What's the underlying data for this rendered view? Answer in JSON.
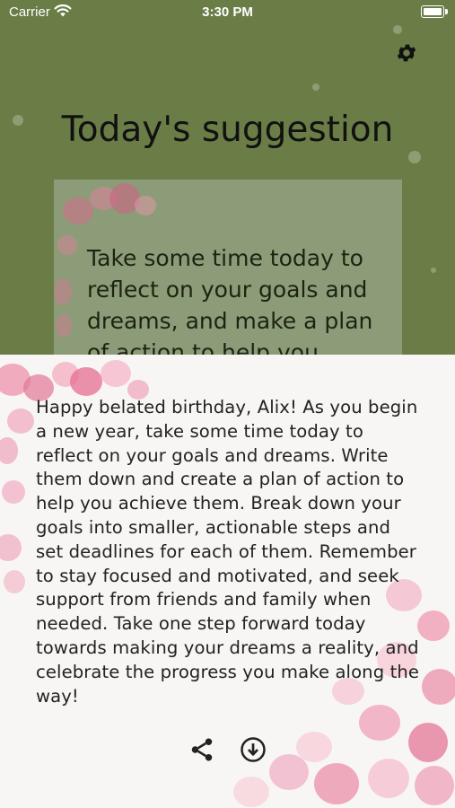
{
  "status_bar": {
    "carrier": "Carrier",
    "time": "3:30 PM"
  },
  "header": {
    "title": "Today's suggestion"
  },
  "preview_card": {
    "text": "Take some time today to reflect on your goals and dreams, and make a plan of action to help you"
  },
  "message": {
    "text": "Happy belated birthday, Alix! As you begin a new year, take some time today to reflect on your goals and dreams. Write them down and create a plan of action to help you achieve them. Break down your goals into smaller, actionable steps and set deadlines for each of them. Remember to stay focused and motivated, and seek support from friends and family when needed. Take one step forward today towards making your dreams a reality, and celebrate the progress you make along the way!"
  },
  "actions": {
    "share_icon": "share-icon",
    "download_icon": "download-circle-icon"
  },
  "colors": {
    "header_bg": "#6a7d46",
    "sheet_bg": "#f8f6f4",
    "flowers": "#e88aa8"
  }
}
